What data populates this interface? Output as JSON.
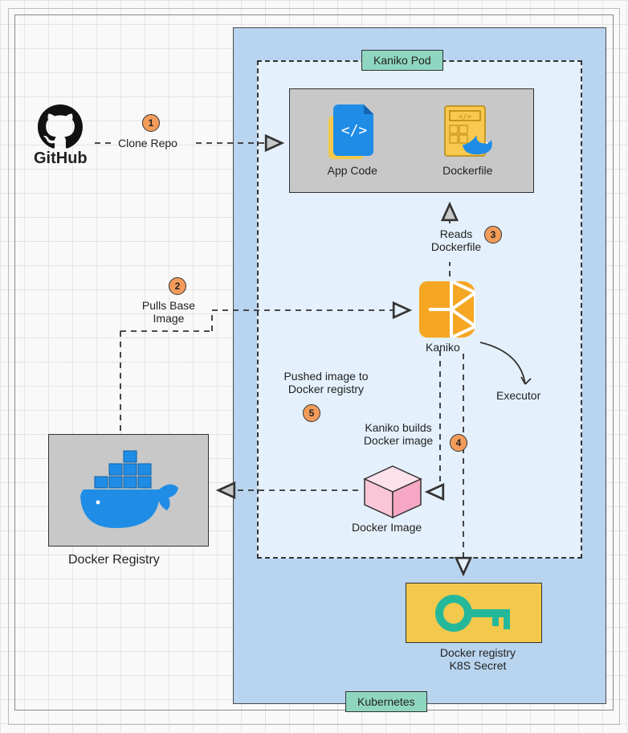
{
  "kubernetes_label": "Kubernetes",
  "pod_label": "Kaniko Pod",
  "github_label": "GitHub",
  "app_code_box": {
    "app_code": "App Code",
    "dockerfile": "Dockerfile"
  },
  "kaniko_label": "Kaniko",
  "docker_image_label": "Docker Image",
  "docker_registry_label": "Docker Registry",
  "secret_label": "Docker registry\nK8S Secret",
  "executor_label": "Executor",
  "steps": {
    "1": {
      "num": "1",
      "label": "Clone Repo"
    },
    "2": {
      "num": "2",
      "label": "Pulls Base Image"
    },
    "3": {
      "num": "3",
      "label": "Reads Dockerfile"
    },
    "4": {
      "num": "4",
      "label": "Kaniko builds Docker image"
    },
    "5": {
      "num": "5",
      "label": "Pushed image to Docker registry"
    }
  },
  "colors": {
    "k8s_bg": "#b8d4ef",
    "pod_bg": "#e4f0fb",
    "badge_bg": "#f39c5a",
    "secret_bg": "#f2c94c",
    "teal": "#8fd6c0",
    "docker_blue": "#1f8de6",
    "kaniko_orange": "#f5a623",
    "pink": "#fbc5d8"
  }
}
